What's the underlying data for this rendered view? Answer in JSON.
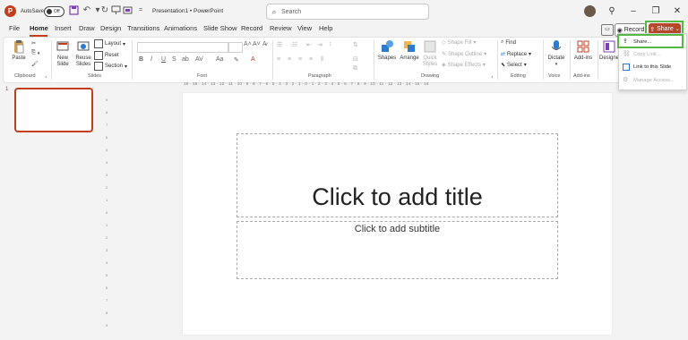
{
  "titlebar": {
    "app_logo": "P",
    "autosave_label": "AutoSave",
    "autosave_state": "Off",
    "document_title": "Presentation1  •  PowerPoint",
    "search_placeholder": "Search",
    "search_icon": "search-icon"
  },
  "tabs": [
    "File",
    "Home",
    "Insert",
    "Draw",
    "Design",
    "Transitions",
    "Animations",
    "Slide Show",
    "Record",
    "Review",
    "View",
    "Help"
  ],
  "active_tab": "Home",
  "actions": {
    "record_label": "Record",
    "share_label": "Share"
  },
  "ribbon": {
    "clipboard": {
      "group": "Clipboard",
      "paste": "Paste"
    },
    "slides": {
      "group": "Slides",
      "new_slide_1": "New",
      "new_slide_2": "Slide",
      "reuse_1": "Reuse",
      "reuse_2": "Slides",
      "layout": "Layout",
      "reset": "Reset",
      "section": "Section"
    },
    "font": {
      "group": "Font"
    },
    "paragraph": {
      "group": "Paragraph"
    },
    "drawing": {
      "group": "Drawing",
      "shapes": "Shapes",
      "arrange": "Arrange",
      "quick_styles_1": "Quick",
      "quick_styles_2": "Styles",
      "shape_fill": "Shape Fill",
      "shape_outline": "Shape Outline",
      "shape_effects": "Shape Effects"
    },
    "editing": {
      "group": "Editing",
      "find": "Find",
      "replace": "Replace",
      "select": "Select"
    },
    "voice": {
      "group": "Voice",
      "dictate": "Dictate"
    },
    "addins": {
      "group": "Add-ins",
      "addins": "Add-ins"
    },
    "designer": {
      "label": "Designe"
    }
  },
  "ruler_h_text": "16 · 15 · 14 · 13 · 12 · 11 · 10 · 9 · 8 · 7 · 6 · 5 · 4 · 3 · 2 · 1 · 0 · 1 · 2 · 3 · 4 · 5 · 6 · 7 · 8 · 9 · 10 · 11 · 12 · 13 · 14 · 15 · 16",
  "ruler_v_labels": [
    "9",
    "8",
    "7",
    "6",
    "5",
    "4",
    "3",
    "2",
    "1",
    "0",
    "1",
    "2",
    "3",
    "4",
    "5",
    "6",
    "7",
    "8",
    "9"
  ],
  "thumbnail": {
    "number": "1"
  },
  "slide": {
    "title_placeholder": "Click to add title",
    "subtitle_placeholder": "Click to add subtitle"
  },
  "share_menu": {
    "items": [
      {
        "label": "Share...",
        "enabled": true
      },
      {
        "label": "Copy Link...",
        "enabled": false
      },
      {
        "label": "Link to this Slide",
        "enabled": true
      },
      {
        "label": "Manage Access...",
        "enabled": false
      }
    ]
  },
  "colors": {
    "accent": "#c43e1c",
    "share": "#b7472a",
    "highlight": "#54b845"
  }
}
